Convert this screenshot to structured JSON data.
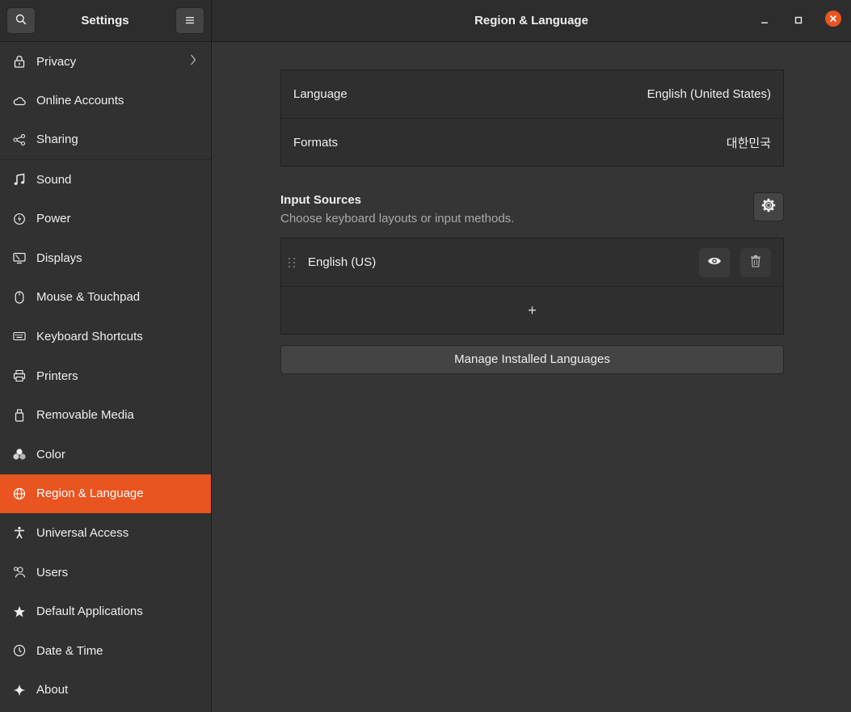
{
  "header": {
    "sidebar_title": "Settings",
    "page_title": "Region & Language",
    "search_icon": "search-icon",
    "menu_icon": "hamburger-menu-icon",
    "close_color": "#e95420"
  },
  "sidebar": {
    "items": [
      {
        "label": "Privacy",
        "icon": "lock-icon"
      },
      {
        "label": "Online Accounts",
        "icon": "cloud-icon"
      },
      {
        "label": "Sharing",
        "icon": "share-icon"
      },
      {
        "label": "Sound",
        "icon": "music-note-icon"
      },
      {
        "label": "Power",
        "icon": "power-icon"
      },
      {
        "label": "Displays",
        "icon": "display-icon"
      },
      {
        "label": "Mouse & Touchpad",
        "icon": "mouse-icon"
      },
      {
        "label": "Keyboard Shortcuts",
        "icon": "keyboard-icon"
      },
      {
        "label": "Printers",
        "icon": "printer-icon"
      },
      {
        "label": "Removable Media",
        "icon": "usb-drive-icon"
      },
      {
        "label": "Color",
        "icon": "color-icon"
      },
      {
        "label": "Region & Language",
        "icon": "globe-icon",
        "active": true
      },
      {
        "label": "Universal Access",
        "icon": "accessibility-icon"
      },
      {
        "label": "Users",
        "icon": "users-icon"
      },
      {
        "label": "Default Applications",
        "icon": "star-icon"
      },
      {
        "label": "Date & Time",
        "icon": "clock-icon"
      },
      {
        "label": "About",
        "icon": "sparkle-icon"
      }
    ],
    "accent": "#e95420"
  },
  "region": {
    "language_label": "Language",
    "language_value": "English (United States)",
    "formats_label": "Formats",
    "formats_value": "대한민국"
  },
  "input_sources": {
    "title": "Input Sources",
    "subtitle": "Choose keyboard layouts or input methods.",
    "sources": [
      {
        "label": "English (US)"
      }
    ],
    "add_symbol": "+"
  },
  "manage_button": "Manage Installed Languages"
}
